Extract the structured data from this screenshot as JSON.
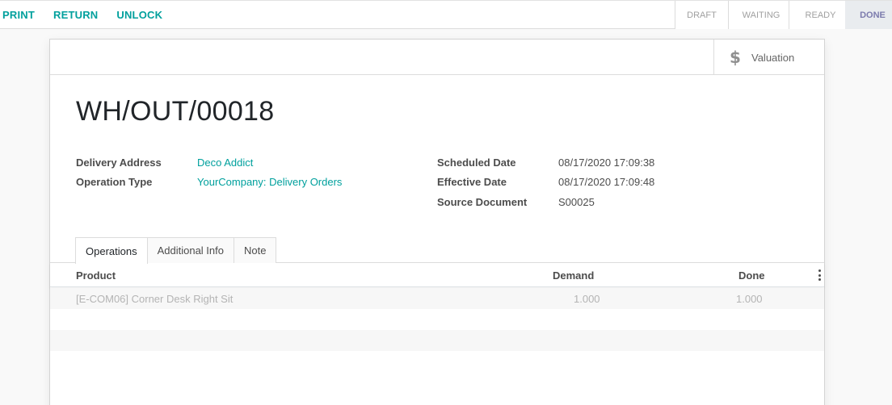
{
  "actions": {
    "print": "Print",
    "return": "Return",
    "unlock": "Unlock"
  },
  "stages": [
    "Draft",
    "Waiting",
    "Ready",
    "Done"
  ],
  "active_stage": "Done",
  "valuation_button": {
    "icon": "dollar-icon",
    "label": "Valuation"
  },
  "record": {
    "name": "WH/OUT/00018",
    "fields_left": [
      {
        "label": "Delivery Address",
        "value": "Deco Addict"
      },
      {
        "label": "Operation Type",
        "value": "YourCompany: Delivery Orders"
      }
    ],
    "fields_right": [
      {
        "label": "Scheduled Date",
        "value": "08/17/2020 17:09:38"
      },
      {
        "label": "Effective Date",
        "value": "08/17/2020 17:09:48"
      },
      {
        "label": "Source Document",
        "value": "S00025"
      }
    ]
  },
  "tabs": [
    "Operations",
    "Additional Info",
    "Note"
  ],
  "active_tab": "Operations",
  "table": {
    "columns": [
      "Product",
      "Demand",
      "Done"
    ],
    "rows": [
      {
        "product": "[E-COM06] Corner Desk Right Sit",
        "demand": "1.000",
        "done": "1.000"
      }
    ]
  },
  "colors": {
    "accent": "#00a09d",
    "done_stage": "#7c7bad"
  }
}
